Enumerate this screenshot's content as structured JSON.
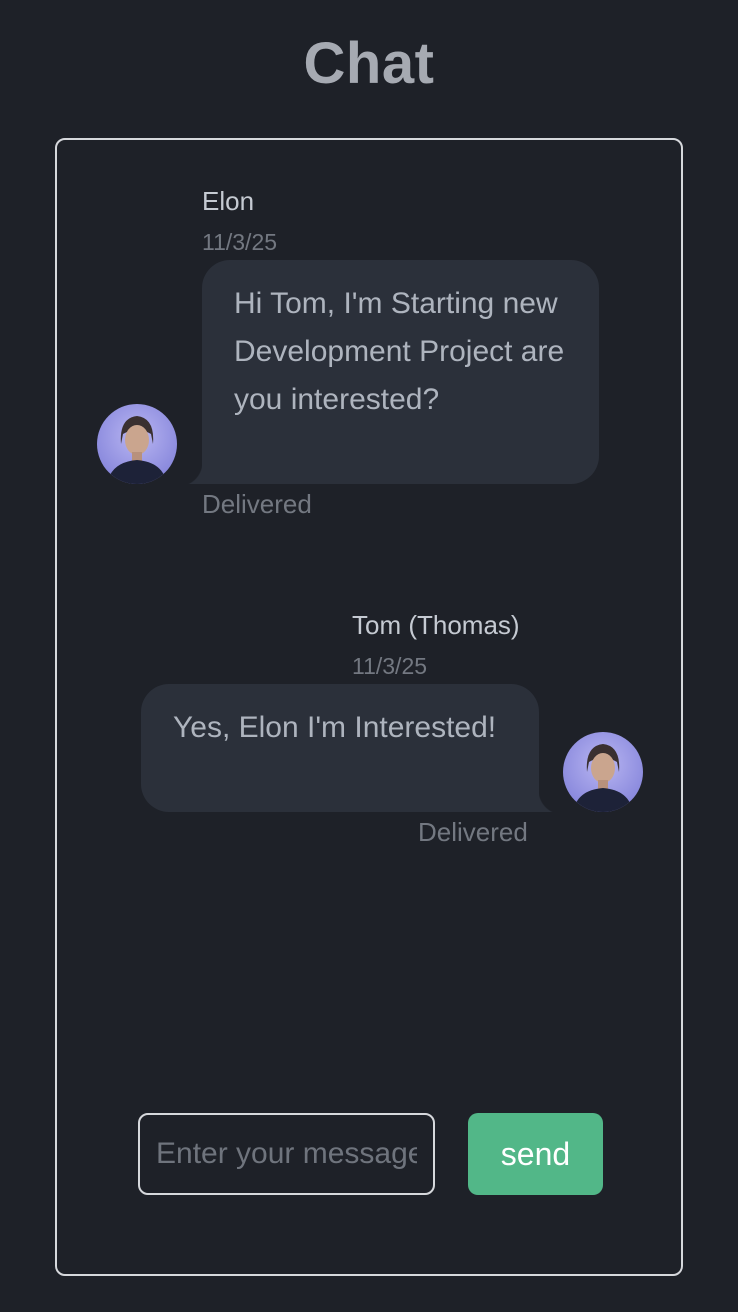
{
  "page": {
    "title": "Chat"
  },
  "messages": [
    {
      "sender": "Elon",
      "date": "11/3/25",
      "text": "Hi Tom, I'm Starting new Development Project are you interested?",
      "status": "Delivered"
    },
    {
      "sender": "Tom (Thomas)",
      "date": "11/3/25",
      "text": "Yes, Elon I'm Interested!",
      "status": "Delivered"
    }
  ],
  "composer": {
    "placeholder": "Enter your message",
    "send_label": "send"
  },
  "colors": {
    "background": "#1e2128",
    "bubble": "#2b303a",
    "send_button": "#52b788",
    "border": "#d6d8dc"
  }
}
